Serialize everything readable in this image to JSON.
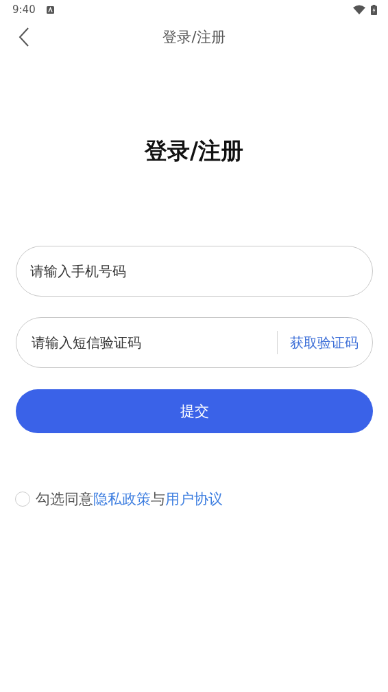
{
  "status_bar": {
    "time": "9:40"
  },
  "header": {
    "title": "登录/注册"
  },
  "heading": "登录/注册",
  "phone_field": {
    "placeholder": "请输入手机号码"
  },
  "code_field": {
    "placeholder": "请输入短信验证码",
    "action": "获取验证码"
  },
  "submit_button": "提交",
  "agreement": {
    "checked": false,
    "parts": [
      {
        "kind": "text",
        "text": "勾选同意"
      },
      {
        "kind": "link",
        "text": "隐私政策"
      },
      {
        "kind": "text",
        "text": "与"
      },
      {
        "kind": "link",
        "text": "用户协议"
      }
    ]
  }
}
